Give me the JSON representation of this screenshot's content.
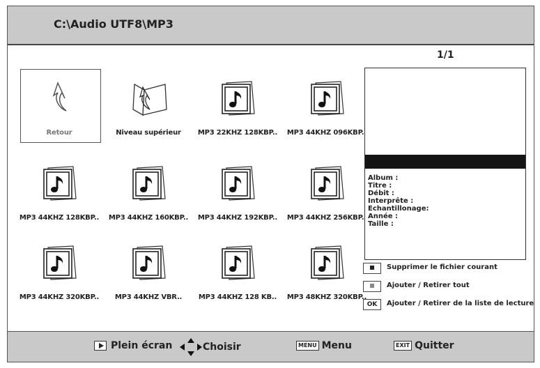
{
  "header": {
    "path": "C:\\Audio UTF8\\MP3"
  },
  "page_indicator": "1/1",
  "files": [
    {
      "label": "Retour",
      "icon": "back-arrow-icon"
    },
    {
      "label": "Niveau supérieur",
      "icon": "folder-up-icon"
    },
    {
      "label": "MP3 22KHZ 128KBP..",
      "icon": "music-file-icon"
    },
    {
      "label": "MP3 44KHZ 096KBP..",
      "icon": "music-file-icon"
    },
    {
      "label": "MP3 44KHZ 128KBP..",
      "icon": "music-file-icon"
    },
    {
      "label": "MP3 44KHZ 160KBP..",
      "icon": "music-file-icon"
    },
    {
      "label": "MP3 44KHZ 192KBP..",
      "icon": "music-file-icon"
    },
    {
      "label": "MP3 44KHZ 256KBP..",
      "icon": "music-file-icon"
    },
    {
      "label": "MP3 44KHZ 320KBP..",
      "icon": "music-file-icon"
    },
    {
      "label": "MP3 44KHZ VBR..",
      "icon": "music-file-icon"
    },
    {
      "label": "MP3 44KHZ 128 KB..",
      "icon": "music-file-icon"
    },
    {
      "label": "MP3 48KHZ 320KBP..",
      "icon": "music-file-icon"
    }
  ],
  "info": {
    "album": "Album :",
    "title": "Titre :",
    "bitrate": "Débit :",
    "artist": "Interprête :",
    "sampling": "Echantillonage:",
    "year": "Année :",
    "size": "Taille :"
  },
  "legend": [
    {
      "key": "",
      "text": "Supprimer le fichier courant"
    },
    {
      "key": "",
      "text": "Ajouter / Retirer tout"
    },
    {
      "key": "OK",
      "text": "Ajouter / Retirer de la liste de lecture"
    }
  ],
  "footer": {
    "fullscreen": "Plein écran",
    "choose": "Choisir",
    "menu_key": "MENU",
    "menu": "Menu",
    "exit_key": "EXIT",
    "quit": "Quitter"
  },
  "colors": {
    "bar": "#c9c9c9",
    "info_bar": "#141414"
  }
}
